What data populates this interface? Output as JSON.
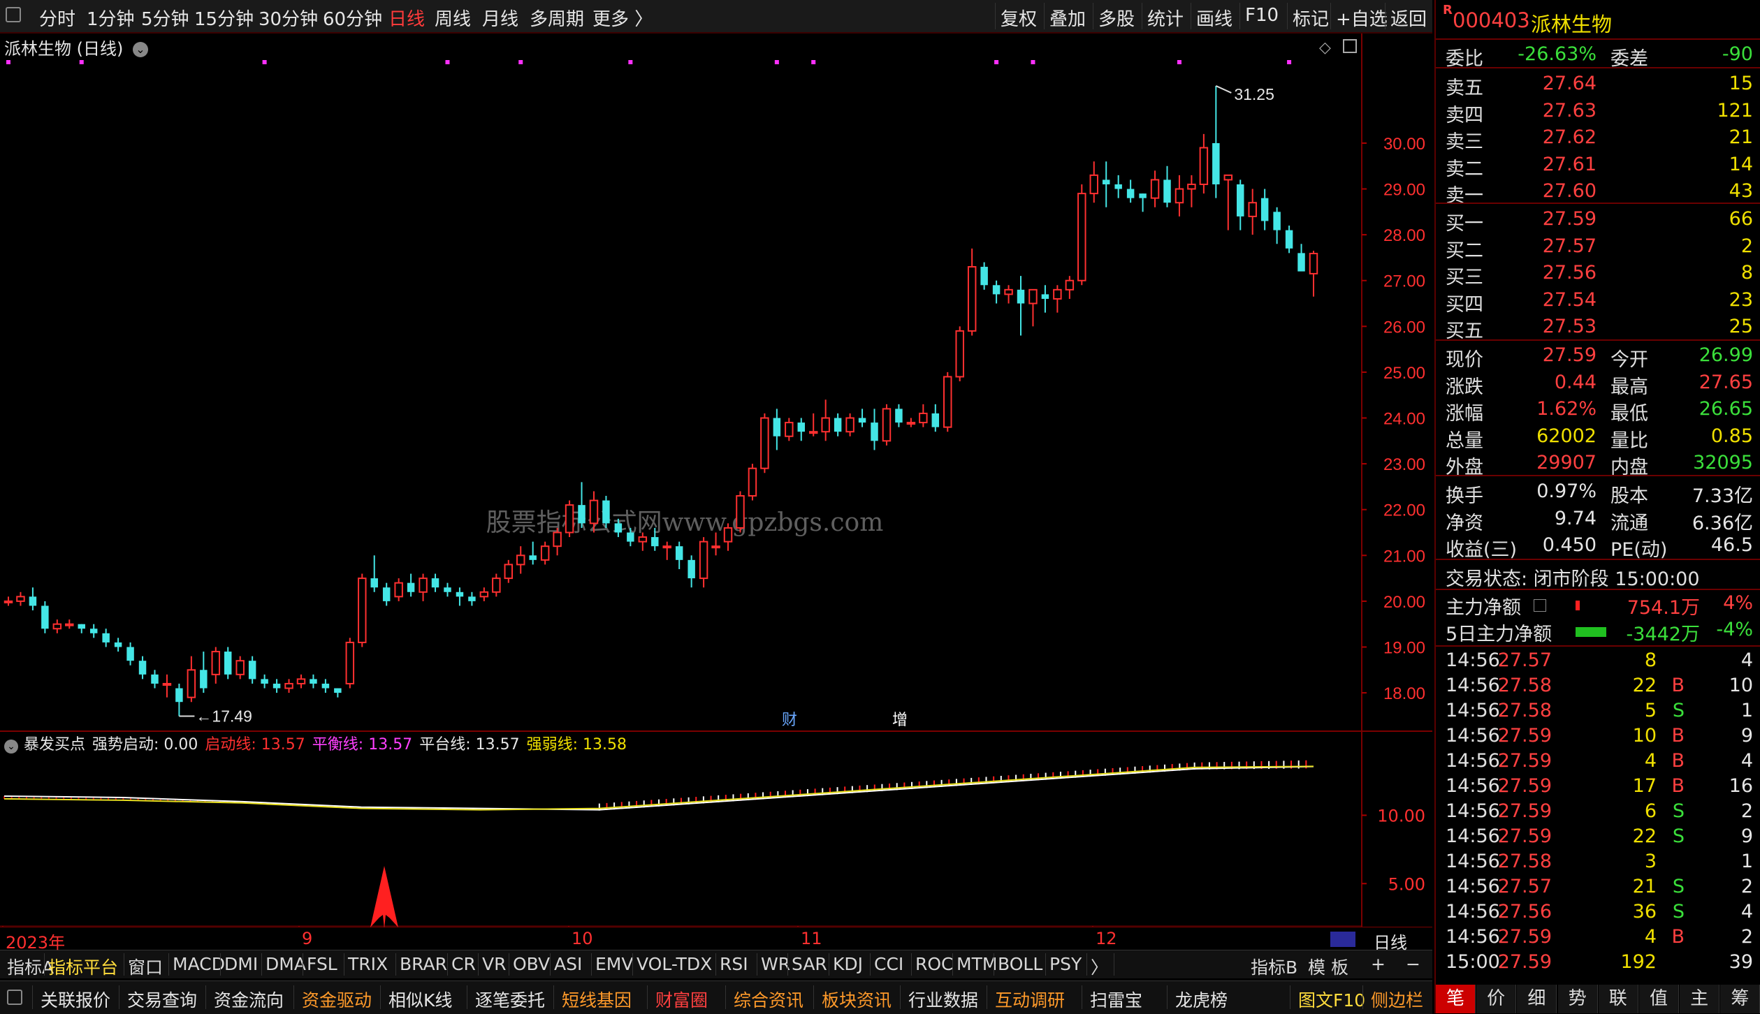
{
  "toolbar": {
    "periods": [
      "分时",
      "1分钟",
      "5分钟",
      "15分钟",
      "30分钟",
      "60分钟",
      "日线",
      "周线",
      "月线",
      "多周期",
      "更多 〉"
    ],
    "active_period": "日线",
    "tools": [
      "复权",
      "叠加",
      "多股",
      "统计",
      "画线",
      "F10",
      "标记",
      "+自选",
      "返回"
    ]
  },
  "chart": {
    "title": "派林生物 (日线)",
    "high_label": "31.25",
    "low_label": "17.49",
    "watermark": "股票指标公式网www.gpzbgs.com",
    "price_ticks": [
      "30.00",
      "29.00",
      "28.00",
      "27.00",
      "26.00",
      "25.00",
      "24.00",
      "23.00",
      "22.00",
      "21.00",
      "20.00",
      "19.00",
      "18.00"
    ],
    "event_marks": [
      {
        "label": "财"
      },
      {
        "label": "增"
      }
    ],
    "x_labels": [
      "2023年",
      "9",
      "10",
      "11",
      "12"
    ],
    "period_label": "日线"
  },
  "indicator": {
    "name": "暴发买点",
    "strong_start": "强势启动: 0.00",
    "start_line": "启动线: 13.57",
    "balance_line": "平衡线: 13.57",
    "platform_line": "平台线: 13.57",
    "strong_weak_line": "强弱线: 13.58",
    "ticks": [
      "10.00",
      "5.00"
    ]
  },
  "indicator_bar": {
    "items": [
      "指标A",
      "指标平台",
      "窗口",
      "MACD",
      "DMI",
      "DMA",
      "FSL",
      "TRIX",
      "BRAR",
      "CR",
      "VR",
      "OBV",
      "ASI",
      "EMV",
      "VOL-TDX",
      "RSI",
      "WR",
      "SAR",
      "KDJ",
      "CCI",
      "ROC",
      "MTM",
      "BOLL",
      "PSY",
      "〉"
    ],
    "right_items": [
      "指标B",
      "模 板",
      "+",
      "−"
    ]
  },
  "function_bar": {
    "items": [
      {
        "label": "关联报价",
        "color": "#e6e6e6"
      },
      {
        "label": "交易查询",
        "color": "#e6e6e6"
      },
      {
        "label": "资金流向",
        "color": "#e6e6e6"
      },
      {
        "label": "资金驱动",
        "color": "#ff9a2a"
      },
      {
        "label": "相似K线",
        "color": "#e6e6e6"
      },
      {
        "label": "逐笔委托",
        "color": "#e6e6e6"
      },
      {
        "label": "短线基因",
        "color": "#ff9a2a"
      },
      {
        "label": "财富圈",
        "color": "#ff4040"
      },
      {
        "label": "综合资讯",
        "color": "#ff9a2a"
      },
      {
        "label": "板块资讯",
        "color": "#ff9a2a"
      },
      {
        "label": "行业数据",
        "color": "#e6e6e6"
      },
      {
        "label": "互动调研",
        "color": "#ff9a2a"
      },
      {
        "label": "扫雷宝",
        "color": "#e6e6e6"
      },
      {
        "label": "龙虎榜",
        "color": "#e6e6e6"
      },
      {
        "label": "图文F10",
        "color": "#ffdc3c"
      },
      {
        "label": "侧边栏",
        "color": "#ff9a2a"
      }
    ]
  },
  "panel": {
    "code": "000403",
    "name": "派林生物",
    "badge": "R",
    "weibi": {
      "label": "委比",
      "value": "-26.63%",
      "diff_label": "委差",
      "diff": "-90"
    },
    "asks": [
      {
        "label": "卖五",
        "price": "27.64",
        "vol": "15"
      },
      {
        "label": "卖四",
        "price": "27.63",
        "vol": "121"
      },
      {
        "label": "卖三",
        "price": "27.62",
        "vol": "21"
      },
      {
        "label": "卖二",
        "price": "27.61",
        "vol": "14"
      },
      {
        "label": "卖一",
        "price": "27.60",
        "vol": "43"
      }
    ],
    "bids": [
      {
        "label": "买一",
        "price": "27.59",
        "vol": "66"
      },
      {
        "label": "买二",
        "price": "27.57",
        "vol": "2"
      },
      {
        "label": "买三",
        "price": "27.56",
        "vol": "8"
      },
      {
        "label": "买四",
        "price": "27.54",
        "vol": "23"
      },
      {
        "label": "买五",
        "price": "27.53",
        "vol": "25"
      }
    ],
    "stats": [
      {
        "l1": "现价",
        "v1": "27.59",
        "c1": "red",
        "l2": "今开",
        "v2": "26.99",
        "c2": "green"
      },
      {
        "l1": "涨跌",
        "v1": "0.44",
        "c1": "red",
        "l2": "最高",
        "v2": "27.65",
        "c2": "red"
      },
      {
        "l1": "涨幅",
        "v1": "1.62%",
        "c1": "red",
        "l2": "最低",
        "v2": "26.65",
        "c2": "green"
      },
      {
        "l1": "总量",
        "v1": "62002",
        "c1": "yellow",
        "l2": "量比",
        "v2": "0.85",
        "c2": "yellow"
      },
      {
        "l1": "外盘",
        "v1": "29907",
        "c1": "red",
        "l2": "内盘",
        "v2": "32095",
        "c2": "green"
      }
    ],
    "stats2": [
      {
        "l1": "换手",
        "v1": "0.97%",
        "l2": "股本",
        "v2": "7.33亿"
      },
      {
        "l1": "净资",
        "v1": "9.74",
        "l2": "流通",
        "v2": "6.36亿"
      },
      {
        "l1": "收益(三)",
        "v1": "0.450",
        "l2": "PE(动)",
        "v2": "46.5"
      }
    ],
    "trade_status": "交易状态: 闭市阶段 15:00:00",
    "main_net": {
      "label": "主力净额",
      "value": "754.1万",
      "pct": "4%"
    },
    "main_net5": {
      "label": "5日主力净额",
      "value": "-3442万",
      "pct": "-4%"
    },
    "ticks": [
      {
        "t": "14:56",
        "p": "27.57",
        "v": "8",
        "bs": "",
        "n": "4",
        "pc": "red"
      },
      {
        "t": "14:56",
        "p": "27.58",
        "v": "22",
        "bs": "B",
        "n": "10",
        "pc": "red"
      },
      {
        "t": "14:56",
        "p": "27.58",
        "v": "5",
        "bs": "S",
        "n": "1",
        "pc": "red"
      },
      {
        "t": "14:56",
        "p": "27.59",
        "v": "10",
        "bs": "B",
        "n": "9",
        "pc": "red"
      },
      {
        "t": "14:56",
        "p": "27.59",
        "v": "4",
        "bs": "B",
        "n": "4",
        "pc": "red"
      },
      {
        "t": "14:56",
        "p": "27.59",
        "v": "17",
        "bs": "B",
        "n": "16",
        "pc": "red"
      },
      {
        "t": "14:56",
        "p": "27.59",
        "v": "6",
        "bs": "S",
        "n": "2",
        "pc": "red"
      },
      {
        "t": "14:56",
        "p": "27.59",
        "v": "22",
        "bs": "S",
        "n": "9",
        "pc": "red"
      },
      {
        "t": "14:56",
        "p": "27.58",
        "v": "3",
        "bs": "",
        "n": "1",
        "pc": "red"
      },
      {
        "t": "14:56",
        "p": "27.57",
        "v": "21",
        "bs": "S",
        "n": "2",
        "pc": "red"
      },
      {
        "t": "14:56",
        "p": "27.56",
        "v": "36",
        "bs": "S",
        "n": "4",
        "pc": "red"
      },
      {
        "t": "14:56",
        "p": "27.59",
        "v": "4",
        "bs": "B",
        "n": "2",
        "pc": "red"
      },
      {
        "t": "15:00",
        "p": "27.59",
        "v": "192",
        "bs": "",
        "n": "39",
        "pc": "red"
      }
    ],
    "bottom_tabs": [
      "笔",
      "价",
      "细",
      "势",
      "联",
      "值",
      "主",
      "筹"
    ]
  },
  "chart_data": {
    "type": "candlestick",
    "title": "派林生物 (日线)",
    "ylim": [
      17.3,
      31.6
    ],
    "candles": [
      [
        20.0,
        20.1,
        19.9,
        20.0
      ],
      [
        20.0,
        20.2,
        19.9,
        20.1
      ],
      [
        20.1,
        20.3,
        19.8,
        19.9
      ],
      [
        19.9,
        20.0,
        19.3,
        19.4
      ],
      [
        19.4,
        19.6,
        19.3,
        19.5
      ],
      [
        19.5,
        19.6,
        19.4,
        19.5
      ],
      [
        19.5,
        19.5,
        19.3,
        19.4
      ],
      [
        19.4,
        19.5,
        19.2,
        19.3
      ],
      [
        19.3,
        19.4,
        19.0,
        19.1
      ],
      [
        19.1,
        19.2,
        18.9,
        19.0
      ],
      [
        19.0,
        19.1,
        18.6,
        18.7
      ],
      [
        18.7,
        18.8,
        18.3,
        18.4
      ],
      [
        18.4,
        18.5,
        18.1,
        18.2
      ],
      [
        18.2,
        18.4,
        17.9,
        18.2
      ],
      [
        18.1,
        18.2,
        17.49,
        17.8
      ],
      [
        17.9,
        18.8,
        17.8,
        18.5
      ],
      [
        18.5,
        18.9,
        18.0,
        18.1
      ],
      [
        18.4,
        19.0,
        18.2,
        18.9
      ],
      [
        18.9,
        19.0,
        18.3,
        18.4
      ],
      [
        18.4,
        18.8,
        18.3,
        18.7
      ],
      [
        18.7,
        18.8,
        18.2,
        18.3
      ],
      [
        18.3,
        18.4,
        18.1,
        18.2
      ],
      [
        18.2,
        18.3,
        18.0,
        18.1
      ],
      [
        18.1,
        18.3,
        18.0,
        18.2
      ],
      [
        18.2,
        18.4,
        18.1,
        18.3
      ],
      [
        18.3,
        18.4,
        18.1,
        18.2
      ],
      [
        18.2,
        18.3,
        18.0,
        18.1
      ],
      [
        18.1,
        18.1,
        17.9,
        18.0
      ],
      [
        18.2,
        19.2,
        18.1,
        19.1
      ],
      [
        19.1,
        20.6,
        19.0,
        20.5
      ],
      [
        20.5,
        21.0,
        20.2,
        20.3
      ],
      [
        20.3,
        20.4,
        19.9,
        20.0
      ],
      [
        20.1,
        20.5,
        20.0,
        20.4
      ],
      [
        20.4,
        20.6,
        20.1,
        20.2
      ],
      [
        20.2,
        20.6,
        20.0,
        20.5
      ],
      [
        20.5,
        20.6,
        20.2,
        20.3
      ],
      [
        20.3,
        20.4,
        20.1,
        20.2
      ],
      [
        20.2,
        20.3,
        19.9,
        20.1
      ],
      [
        20.1,
        20.2,
        19.9,
        20.0
      ],
      [
        20.1,
        20.3,
        20.0,
        20.2
      ],
      [
        20.2,
        20.6,
        20.1,
        20.5
      ],
      [
        20.5,
        20.9,
        20.4,
        20.8
      ],
      [
        20.8,
        21.2,
        20.6,
        21.0
      ],
      [
        21.0,
        21.3,
        20.8,
        20.9
      ],
      [
        20.9,
        21.3,
        20.8,
        21.2
      ],
      [
        21.2,
        21.6,
        21.0,
        21.5
      ],
      [
        21.5,
        22.2,
        21.4,
        22.1
      ],
      [
        22.1,
        22.6,
        21.6,
        21.7
      ],
      [
        21.7,
        22.4,
        21.5,
        22.2
      ],
      [
        22.2,
        22.3,
        21.6,
        21.7
      ],
      [
        21.7,
        21.8,
        21.4,
        21.5
      ],
      [
        21.5,
        21.6,
        21.2,
        21.3
      ],
      [
        21.3,
        21.5,
        21.1,
        21.4
      ],
      [
        21.4,
        21.6,
        21.1,
        21.2
      ],
      [
        21.2,
        21.3,
        20.9,
        21.2
      ],
      [
        21.2,
        21.3,
        20.7,
        20.9
      ],
      [
        20.9,
        21.0,
        20.3,
        20.5
      ],
      [
        20.5,
        21.4,
        20.3,
        21.3
      ],
      [
        21.2,
        21.5,
        21.0,
        21.2
      ],
      [
        21.3,
        21.7,
        21.1,
        21.6
      ],
      [
        21.6,
        22.4,
        21.5,
        22.3
      ],
      [
        22.3,
        23.0,
        22.2,
        22.9
      ],
      [
        22.9,
        24.1,
        22.8,
        24.0
      ],
      [
        24.0,
        24.2,
        23.3,
        23.6
      ],
      [
        23.6,
        24.0,
        23.5,
        23.9
      ],
      [
        23.9,
        24.0,
        23.5,
        23.7
      ],
      [
        23.7,
        24.1,
        23.6,
        23.7
      ],
      [
        23.7,
        24.4,
        23.5,
        24.0
      ],
      [
        24.0,
        24.1,
        23.6,
        23.7
      ],
      [
        23.7,
        24.1,
        23.6,
        24.0
      ],
      [
        24.0,
        24.2,
        23.8,
        23.9
      ],
      [
        23.9,
        24.2,
        23.3,
        23.5
      ],
      [
        23.5,
        24.3,
        23.4,
        24.2
      ],
      [
        24.2,
        24.3,
        23.8,
        23.9
      ],
      [
        23.9,
        24.0,
        23.8,
        23.9
      ],
      [
        23.9,
        24.3,
        23.8,
        24.1
      ],
      [
        24.1,
        24.3,
        23.7,
        23.8
      ],
      [
        23.8,
        25.0,
        23.7,
        24.9
      ],
      [
        24.9,
        26.0,
        24.8,
        25.9
      ],
      [
        25.9,
        27.7,
        25.8,
        27.3
      ],
      [
        27.3,
        27.4,
        26.8,
        26.9
      ],
      [
        26.9,
        27.0,
        26.5,
        26.7
      ],
      [
        26.7,
        26.9,
        26.5,
        26.8
      ],
      [
        26.8,
        27.1,
        25.8,
        26.5
      ],
      [
        26.5,
        26.8,
        26.0,
        26.8
      ],
      [
        26.7,
        26.9,
        26.3,
        26.6
      ],
      [
        26.6,
        26.9,
        26.3,
        26.8
      ],
      [
        26.8,
        27.1,
        26.6,
        27.0
      ],
      [
        27.0,
        29.1,
        26.9,
        28.9
      ],
      [
        28.9,
        29.6,
        28.7,
        29.3
      ],
      [
        29.2,
        29.6,
        28.6,
        29.1
      ],
      [
        29.1,
        29.3,
        28.8,
        29.0
      ],
      [
        29.0,
        29.2,
        28.7,
        28.8
      ],
      [
        28.9,
        28.9,
        28.5,
        28.8
      ],
      [
        28.8,
        29.4,
        28.6,
        29.2
      ],
      [
        29.2,
        29.5,
        28.6,
        28.7
      ],
      [
        28.7,
        29.3,
        28.4,
        29.0
      ],
      [
        29.0,
        29.3,
        28.6,
        29.1
      ],
      [
        29.1,
        30.2,
        28.9,
        29.9
      ],
      [
        30.0,
        31.25,
        28.8,
        29.1
      ],
      [
        29.2,
        29.3,
        28.1,
        29.3
      ],
      [
        29.1,
        29.2,
        28.1,
        28.4
      ],
      [
        28.4,
        29.0,
        28.0,
        28.7
      ],
      [
        28.8,
        29.0,
        28.1,
        28.3
      ],
      [
        28.5,
        28.6,
        27.8,
        28.1
      ],
      [
        28.1,
        28.2,
        27.6,
        27.7
      ],
      [
        27.6,
        27.8,
        27.3,
        27.2
      ],
      [
        27.15,
        27.65,
        26.65,
        27.59
      ]
    ],
    "indicator_series": [
      {
        "name": "平衡线",
        "values": [
          11.4,
          11.3,
          11.0,
          10.6,
          10.5,
          10.4,
          11.0,
          11.6,
          12.2,
          12.8,
          13.4,
          13.57
        ]
      },
      {
        "name": "强弱线",
        "values": [
          11.2,
          11.1,
          10.9,
          10.5,
          10.4,
          10.5,
          11.1,
          11.7,
          12.3,
          12.9,
          13.5,
          13.58
        ]
      }
    ]
  }
}
